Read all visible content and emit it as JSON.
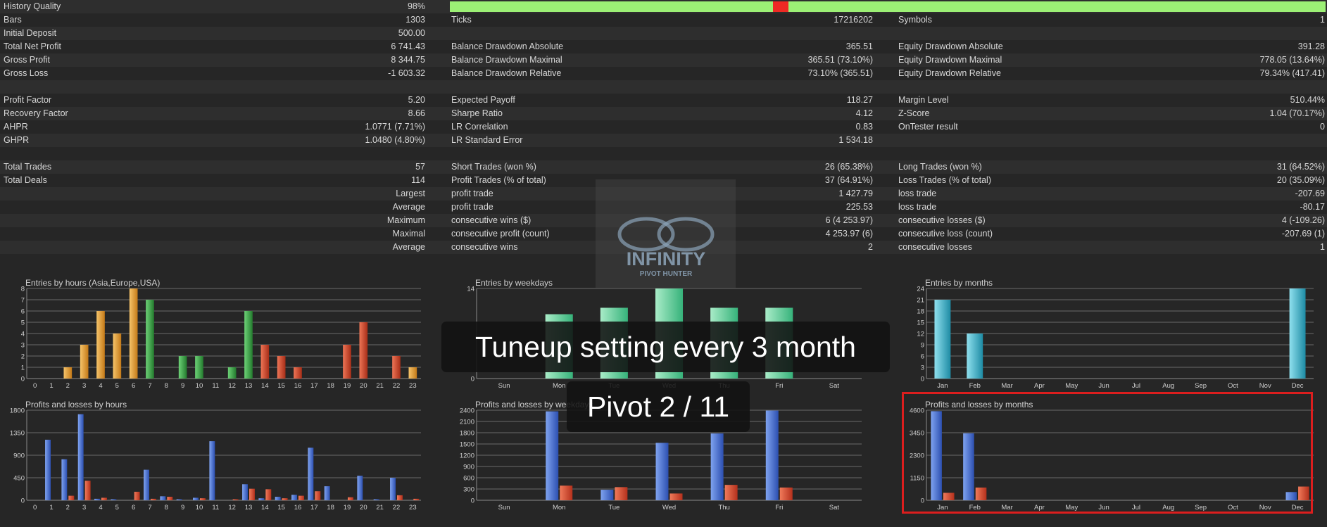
{
  "stats": {
    "history_quality": {
      "label": "History Quality",
      "value": "98%",
      "fraction": 0.98
    },
    "rows": [
      {
        "a_label": "Bars",
        "a_value": "1303",
        "b_label": "Ticks",
        "b_value": "17216202",
        "c_label": "Symbols",
        "c_value": "1"
      },
      {
        "a_label": "Initial Deposit",
        "a_value": "500.00",
        "b_label": "",
        "b_value": "",
        "c_label": "",
        "c_value": ""
      },
      {
        "a_label": "Total Net Profit",
        "a_value": "6 741.43",
        "b_label": "Balance Drawdown Absolute",
        "b_value": "365.51",
        "c_label": "Equity Drawdown Absolute",
        "c_value": "391.28"
      },
      {
        "a_label": "Gross Profit",
        "a_value": "8 344.75",
        "b_label": "Balance Drawdown Maximal",
        "b_value": "365.51 (73.10%)",
        "c_label": "Equity Drawdown Maximal",
        "c_value": "778.05 (13.64%)"
      },
      {
        "a_label": "Gross Loss",
        "a_value": "-1 603.32",
        "b_label": "Balance Drawdown Relative",
        "b_value": "73.10% (365.51)",
        "c_label": "Equity Drawdown Relative",
        "c_value": "79.34% (417.41)"
      },
      {
        "a_label": "",
        "a_value": "",
        "b_label": "",
        "b_value": "",
        "c_label": "",
        "c_value": ""
      },
      {
        "a_label": "Profit Factor",
        "a_value": "5.20",
        "b_label": "Expected Payoff",
        "b_value": "118.27",
        "c_label": "Margin Level",
        "c_value": "510.44%"
      },
      {
        "a_label": "Recovery Factor",
        "a_value": "8.66",
        "b_label": "Sharpe Ratio",
        "b_value": "4.12",
        "c_label": "Z-Score",
        "c_value": "1.04 (70.17%)"
      },
      {
        "a_label": "AHPR",
        "a_value": "1.0771 (7.71%)",
        "b_label": "LR Correlation",
        "b_value": "0.83",
        "c_label": "OnTester result",
        "c_value": "0"
      },
      {
        "a_label": "GHPR",
        "a_value": "1.0480 (4.80%)",
        "b_label": "LR Standard Error",
        "b_value": "1 534.18",
        "c_label": "",
        "c_value": ""
      },
      {
        "a_label": "",
        "a_value": "",
        "b_label": "",
        "b_value": "",
        "c_label": "",
        "c_value": ""
      },
      {
        "a_label": "Total Trades",
        "a_value": "57",
        "b_label": "Short Trades (won %)",
        "b_value": "26 (65.38%)",
        "c_label": "Long Trades (won %)",
        "c_value": "31 (64.52%)"
      },
      {
        "a_label": "Total Deals",
        "a_value": "114",
        "b_label": "Profit Trades (% of total)",
        "b_value": "37 (64.91%)",
        "c_label": "Loss Trades (% of total)",
        "c_value": "20 (35.09%)"
      },
      {
        "a_label": "",
        "a_value": "Largest",
        "b_label": "profit trade",
        "b_value": "1 427.79",
        "c_label": "loss trade",
        "c_value": "-207.69"
      },
      {
        "a_label": "",
        "a_value": "Average",
        "b_label": "profit trade",
        "b_value": "225.53",
        "c_label": "loss trade",
        "c_value": "-80.17"
      },
      {
        "a_label": "",
        "a_value": "Maximum",
        "b_label": "consecutive wins ($)",
        "b_value": "6 (4 253.97)",
        "c_label": "consecutive losses ($)",
        "c_value": "4 (-109.26)"
      },
      {
        "a_label": "",
        "a_value": "Maximal",
        "b_label": "consecutive profit (count)",
        "b_value": "4 253.97 (6)",
        "c_label": "consecutive loss (count)",
        "c_value": "-207.69 (1)"
      },
      {
        "a_label": "",
        "a_value": "Average",
        "b_label": "consecutive wins",
        "b_value": "2",
        "c_label": "consecutive losses",
        "c_value": "1"
      },
      {
        "a_label": "",
        "a_value": "",
        "b_label": "",
        "b_value": "",
        "c_label": "",
        "c_value": ""
      }
    ]
  },
  "colors": {
    "history_bar": "#9cf075",
    "history_red": "#ee2a24",
    "asia": "#e8a032",
    "europe": "#3cae46",
    "usa": "#d9452c",
    "weekday_bar": "#6ad6a2",
    "month_bar": "#3bb6cc",
    "profit": "#4a74d6",
    "loss": "#d9452c",
    "highlight": "#dc1e1e"
  },
  "overlay": {
    "line1": "Tuneup setting every 3 month",
    "line2": "Pivot 2 / 11"
  },
  "logo": {
    "text": "INFINITY",
    "subtext": "PIVOT HUNTER"
  },
  "chart_data": [
    {
      "type": "bar",
      "title": "Entries by hours (Asia,Europe,USA)",
      "categories": [
        "0",
        "1",
        "2",
        "3",
        "4",
        "5",
        "6",
        "7",
        "8",
        "9",
        "10",
        "11",
        "12",
        "13",
        "14",
        "15",
        "16",
        "17",
        "18",
        "19",
        "20",
        "21",
        "22",
        "23"
      ],
      "series": [
        {
          "values": [
            0,
            0,
            1,
            3,
            6,
            4,
            8,
            7,
            0,
            2,
            2,
            0,
            1,
            6,
            3,
            2,
            1,
            0,
            0,
            3,
            5,
            0,
            2,
            1
          ]
        }
      ],
      "bar_colors": [
        "asia",
        "asia",
        "asia",
        "asia",
        "asia",
        "asia",
        "asia",
        "europe",
        "europe",
        "europe",
        "europe",
        "europe",
        "europe",
        "europe",
        "usa",
        "usa",
        "usa",
        "usa",
        "usa",
        "usa",
        "usa",
        "usa",
        "usa",
        "asia"
      ],
      "ylim": [
        0,
        8
      ],
      "yticks": [
        "0",
        "1",
        "2",
        "3",
        "4",
        "5",
        "6",
        "7",
        "8"
      ]
    },
    {
      "type": "bar",
      "title": "Entries by weekdays",
      "categories": [
        "Sun",
        "Mon",
        "Tue",
        "Wed",
        "Thu",
        "Fri",
        "Sat"
      ],
      "series": [
        {
          "values": [
            0,
            10,
            11,
            14,
            11,
            11,
            0
          ]
        }
      ],
      "ylim": [
        0,
        14
      ],
      "yticks": [
        "0",
        "14"
      ]
    },
    {
      "type": "bar",
      "title": "Entries by months",
      "categories": [
        "Jan",
        "Feb",
        "Mar",
        "Apr",
        "May",
        "Jun",
        "Jul",
        "Aug",
        "Sep",
        "Oct",
        "Nov",
        "Dec"
      ],
      "series": [
        {
          "values": [
            21,
            12,
            0,
            0,
            0,
            0,
            0,
            0,
            0,
            0,
            0,
            24
          ]
        }
      ],
      "ylim": [
        0,
        24
      ],
      "yticks": [
        "0",
        "3",
        "6",
        "9",
        "12",
        "15",
        "18",
        "21",
        "24"
      ]
    },
    {
      "type": "bar",
      "title": "Profits and losses by hours",
      "categories": [
        "0",
        "1",
        "2",
        "3",
        "4",
        "5",
        "6",
        "7",
        "8",
        "9",
        "10",
        "11",
        "12",
        "13",
        "14",
        "15",
        "16",
        "17",
        "18",
        "19",
        "20",
        "21",
        "22",
        "23"
      ],
      "series": [
        {
          "values": [
            0,
            1210,
            820,
            1720,
            30,
            20,
            0,
            610,
            80,
            20,
            50,
            1180,
            0,
            320,
            40,
            70,
            110,
            1050,
            280,
            0,
            490,
            20,
            450,
            0
          ]
        },
        {
          "values": [
            0,
            0,
            90,
            390,
            50,
            0,
            170,
            30,
            70,
            0,
            40,
            0,
            20,
            230,
            220,
            40,
            90,
            180,
            0,
            60,
            0,
            0,
            100,
            30
          ]
        }
      ],
      "ylim": [
        0,
        1800
      ],
      "yticks": [
        "0",
        "450",
        "900",
        "1350",
        "1800"
      ]
    },
    {
      "type": "bar",
      "title": "Profits and losses by weekdays",
      "categories": [
        "Sun",
        "Mon",
        "Tue",
        "Wed",
        "Thu",
        "Fri",
        "Sat"
      ],
      "series": [
        {
          "values": [
            0,
            2370,
            280,
            1530,
            1780,
            2390,
            0
          ]
        },
        {
          "values": [
            0,
            390,
            350,
            180,
            410,
            340,
            0
          ]
        }
      ],
      "ylim": [
        0,
        2400
      ],
      "yticks": [
        "0",
        "300",
        "600",
        "900",
        "1200",
        "1500",
        "1800",
        "2100",
        "2400"
      ]
    },
    {
      "type": "bar",
      "title": "Profits and losses by months",
      "categories": [
        "Jan",
        "Feb",
        "Mar",
        "Apr",
        "May",
        "Jun",
        "Jul",
        "Aug",
        "Sep",
        "Oct",
        "Nov",
        "Dec"
      ],
      "series": [
        {
          "values": [
            4550,
            3420,
            0,
            0,
            0,
            0,
            0,
            0,
            0,
            0,
            0,
            420
          ]
        },
        {
          "values": [
            380,
            650,
            0,
            0,
            0,
            0,
            0,
            0,
            0,
            0,
            0,
            700
          ]
        }
      ],
      "ylim": [
        0,
        4600
      ],
      "yticks": [
        "0",
        "1150",
        "2300",
        "3450",
        "4600"
      ]
    }
  ]
}
